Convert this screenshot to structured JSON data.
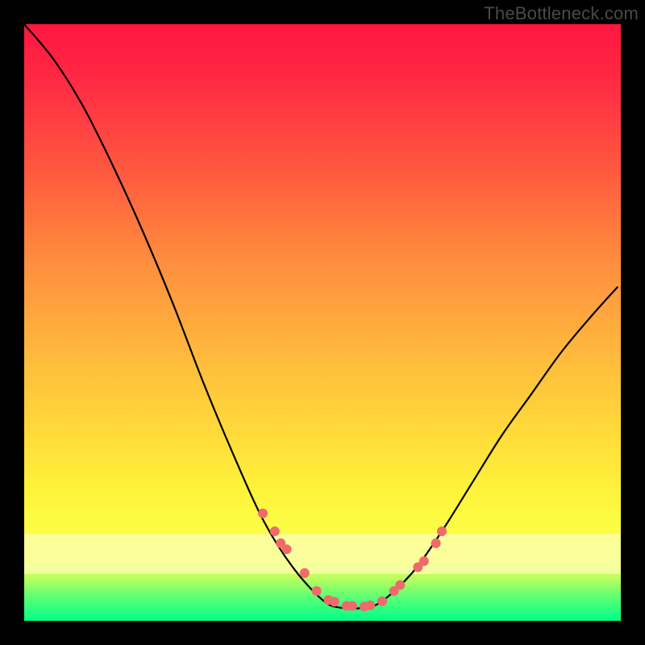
{
  "watermark": "TheBottleneck.com",
  "chart_data": {
    "type": "line",
    "title": "",
    "xlabel": "",
    "ylabel": "",
    "xlim": [
      0,
      100
    ],
    "ylim": [
      0,
      100
    ],
    "legend": false,
    "grid": false,
    "background": {
      "orientation": "vertical",
      "stops": [
        {
          "pos": 0.0,
          "color": "#ff163f"
        },
        {
          "pos": 0.25,
          "color": "#ff5a3f"
        },
        {
          "pos": 0.55,
          "color": "#ffb83d"
        },
        {
          "pos": 0.78,
          "color": "#fff23a"
        },
        {
          "pos": 0.93,
          "color": "#b8ff60"
        },
        {
          "pos": 1.0,
          "color": "#00ff88"
        }
      ]
    },
    "wash_band": {
      "from_y_pct": 0.852,
      "to_y_pct": 0.921,
      "color": "#feffb0",
      "opacity": 0.78
    },
    "series": [
      {
        "name": "bottleneck-curve",
        "color": "#000000",
        "stroke_width": 2,
        "x": [
          0,
          5,
          10,
          15,
          20,
          25,
          30,
          35,
          40,
          45,
          50,
          53,
          57,
          60,
          65,
          70,
          75,
          80,
          85,
          90,
          95,
          99.5
        ],
        "y": [
          100,
          94,
          86,
          76,
          65,
          53,
          40,
          28,
          17,
          9,
          3.5,
          2.2,
          2.2,
          3.3,
          8,
          15,
          23,
          31,
          38,
          45,
          51,
          56
        ]
      },
      {
        "name": "highlight-dots",
        "color": "#ef6a6a",
        "type": "scatter",
        "marker_radius": 6,
        "x": [
          40,
          42,
          43,
          44,
          47,
          49,
          51,
          52,
          54,
          55,
          57,
          58,
          60,
          62,
          63,
          66,
          67,
          69,
          70
        ],
        "y": [
          18,
          15,
          13,
          12,
          8,
          5,
          3.5,
          3.2,
          2.5,
          2.5,
          2.4,
          2.6,
          3.3,
          5,
          6,
          9,
          10,
          13,
          15
        ]
      }
    ]
  }
}
